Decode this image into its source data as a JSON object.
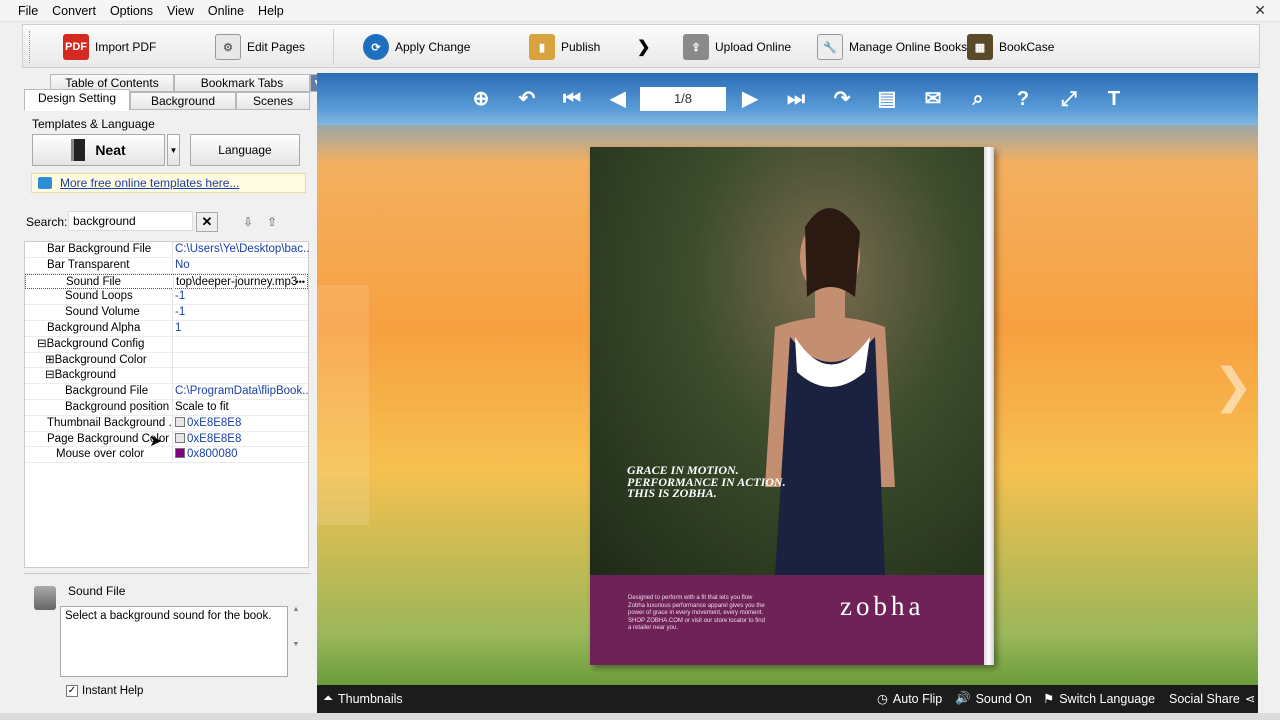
{
  "menu": {
    "file": "File",
    "convert": "Convert",
    "options": "Options",
    "view": "View",
    "online": "Online",
    "help": "Help"
  },
  "toolbar": {
    "import": "Import PDF",
    "edit": "Edit Pages",
    "apply": "Apply Change",
    "publish": "Publish",
    "upload": "Upload Online",
    "manage": "Manage Online Books",
    "bookcase": "BookCase"
  },
  "tabs": {
    "toc": "Table of Contents",
    "bookmark": "Bookmark Tabs",
    "design": "Design Setting",
    "background": "Background",
    "scenes": "Scenes"
  },
  "templates": {
    "label": "Templates & Language",
    "template_name": "Neat",
    "language_label": "Language",
    "more_link": "More free online templates here..."
  },
  "search": {
    "label": "Search:",
    "value": "background"
  },
  "props": [
    {
      "k": "Bar Background File",
      "v": "C:\\Users\\Ye\\Desktop\\bac..."
    },
    {
      "k": "Bar Transparent",
      "v": "No"
    },
    {
      "k": "Sound File",
      "v": "top\\deeper-journey.mp3"
    },
    {
      "k": "Sound Loops",
      "v": "-1"
    },
    {
      "k": "Sound Volume",
      "v": "-1"
    },
    {
      "k": "Background Alpha",
      "v": "1"
    },
    {
      "k": "Background Config",
      "v": ""
    },
    {
      "k": "Background Color",
      "v": ""
    },
    {
      "k": "Background",
      "v": ""
    },
    {
      "k": "Background File",
      "v": "C:\\ProgramData\\flipBook..."
    },
    {
      "k": "Background position",
      "v": "Scale to fit"
    },
    {
      "k": "Thumbnail Background ...",
      "v": "0xE8E8E8"
    },
    {
      "k": "Page Background Color",
      "v": "0xE8E8E8"
    },
    {
      "k": "Mouse over color",
      "v": "0x800080"
    }
  ],
  "help": {
    "title": "Sound File",
    "text": "Select a background sound for the book.",
    "instant": "Instant Help"
  },
  "viewer": {
    "page_indicator": "1/8",
    "headline": [
      "GRACE IN MOTION.",
      "PERFORMANCE IN ACTION.",
      "THIS IS ZOBHA."
    ],
    "brand": "zobha",
    "ad_copy": "Designed to perform with a fit that lets you flow Zobha luxurious performance apparel gives you the power of grace in every movement, every moment. SHOP ZOBHA.COM or visit our store locator to find a retailer near you.",
    "bottom": {
      "thumbnails": "Thumbnails",
      "autoflip": "Auto Flip",
      "sound": "Sound On",
      "switch_lang": "Switch Language",
      "social": "Social Share"
    }
  },
  "colors": {
    "swatch_thumb": "#E8E8E8",
    "swatch_page": "#E8E8E8",
    "swatch_mouse": "#800080"
  }
}
